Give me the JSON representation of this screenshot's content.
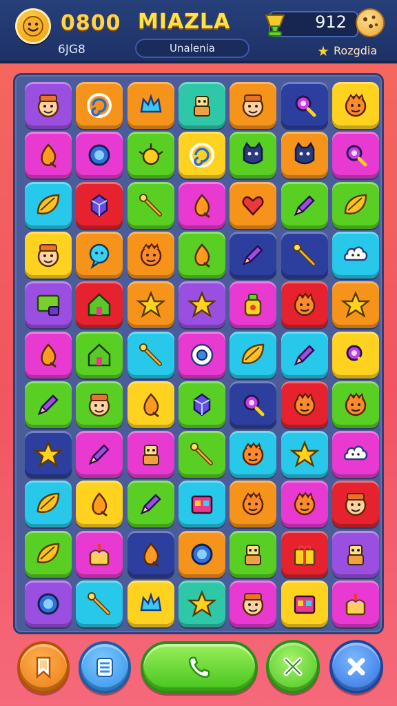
{
  "header": {
    "score": "0800",
    "subscore": "6JG8",
    "title": "MIAZLA",
    "level_label": "Unalenia",
    "coins": "912",
    "bonus_label": "Rozgdia",
    "icons": {
      "avatar": "smiley-avatar-icon",
      "gem": "gem-trophy-icon",
      "cookie": "cookie-icon",
      "star": "star-icon"
    }
  },
  "board": {
    "rows": 11,
    "cols": 7,
    "tiles": [
      [
        "purple",
        "face"
      ],
      [
        "orange",
        "swirl"
      ],
      [
        "orange",
        "crown"
      ],
      [
        "teal",
        "robot"
      ],
      [
        "orange",
        "face"
      ],
      [
        "navy",
        "magnifier"
      ],
      [
        "yellow",
        "monster"
      ],
      [
        "magenta",
        "drop"
      ],
      [
        "magenta",
        "ring"
      ],
      [
        "green",
        "bug"
      ],
      [
        "yellow",
        "swirl"
      ],
      [
        "green",
        "cat"
      ],
      [
        "orange",
        "cat"
      ],
      [
        "magenta",
        "magnifier"
      ],
      [
        "cyan",
        "leaf"
      ],
      [
        "red",
        "gem"
      ],
      [
        "green",
        "wand"
      ],
      [
        "magenta",
        "drop"
      ],
      [
        "orange",
        "heart"
      ],
      [
        "green",
        "pencil"
      ],
      [
        "green",
        "leaf"
      ],
      [
        "yellow",
        "face"
      ],
      [
        "orange",
        "bubble"
      ],
      [
        "orange",
        "monster"
      ],
      [
        "green",
        "drop"
      ],
      [
        "navy",
        "pencil"
      ],
      [
        "navy",
        "wand"
      ],
      [
        "cyan",
        "cloud"
      ],
      [
        "purple",
        "block"
      ],
      [
        "red",
        "house"
      ],
      [
        "orange",
        "star"
      ],
      [
        "purple",
        "star"
      ],
      [
        "magenta",
        "bottle"
      ],
      [
        "red",
        "monster"
      ],
      [
        "orange",
        "star"
      ],
      [
        "magenta",
        "drop"
      ],
      [
        "green",
        "house"
      ],
      [
        "cyan",
        "wand"
      ],
      [
        "magenta",
        "flower"
      ],
      [
        "cyan",
        "leaf"
      ],
      [
        "cyan",
        "pencil"
      ],
      [
        "yellow",
        "magnifier"
      ],
      [
        "green",
        "pencil"
      ],
      [
        "green",
        "face"
      ],
      [
        "yellow",
        "drop"
      ],
      [
        "green",
        "gem"
      ],
      [
        "navy",
        "magnifier"
      ],
      [
        "red",
        "monster"
      ],
      [
        "green",
        "monster"
      ],
      [
        "navy",
        "star"
      ],
      [
        "magenta",
        "pencil"
      ],
      [
        "magenta",
        "robot"
      ],
      [
        "green",
        "wand"
      ],
      [
        "cyan",
        "monster"
      ],
      [
        "cyan",
        "star"
      ],
      [
        "magenta",
        "cloud"
      ],
      [
        "cyan",
        "leaf"
      ],
      [
        "yellow",
        "drop"
      ],
      [
        "green",
        "pencil"
      ],
      [
        "cyan",
        "box"
      ],
      [
        "orange",
        "monster"
      ],
      [
        "magenta",
        "monster"
      ],
      [
        "red",
        "face"
      ],
      [
        "green",
        "leaf"
      ],
      [
        "magenta",
        "cake"
      ],
      [
        "navy",
        "drop"
      ],
      [
        "orange",
        "ring"
      ],
      [
        "green",
        "robot"
      ],
      [
        "red",
        "gift"
      ],
      [
        "purple",
        "robot"
      ],
      [
        "purple",
        "ring"
      ],
      [
        "cyan",
        "wand"
      ],
      [
        "yellow",
        "crown"
      ],
      [
        "teal",
        "star"
      ],
      [
        "magenta",
        "face"
      ],
      [
        "yellow",
        "box"
      ],
      [
        "magenta",
        "cake"
      ]
    ]
  },
  "footer": {
    "buttons": [
      {
        "name": "bookmark-button",
        "icon": "bookmark-icon",
        "color": "#f08a1e"
      },
      {
        "name": "menu-button",
        "icon": "list-icon",
        "color": "#2f8ee8"
      },
      {
        "name": "call-button",
        "icon": "phone-icon",
        "color": "#46c41e"
      },
      {
        "name": "shuffle-button",
        "icon": "cross-arrows-icon",
        "color": "#46c41e"
      },
      {
        "name": "close-button",
        "icon": "close-icon",
        "color": "#2f6fe0"
      }
    ]
  },
  "palette": {
    "purple": "#9b4fe0",
    "orange": "#f6931a",
    "teal": "#2ec8a8",
    "navy": "#2d3f9e",
    "yellow": "#ffd21f",
    "magenta": "#e83ad0",
    "green": "#58cf22",
    "cyan": "#27c8ea",
    "red": "#e5222e"
  }
}
